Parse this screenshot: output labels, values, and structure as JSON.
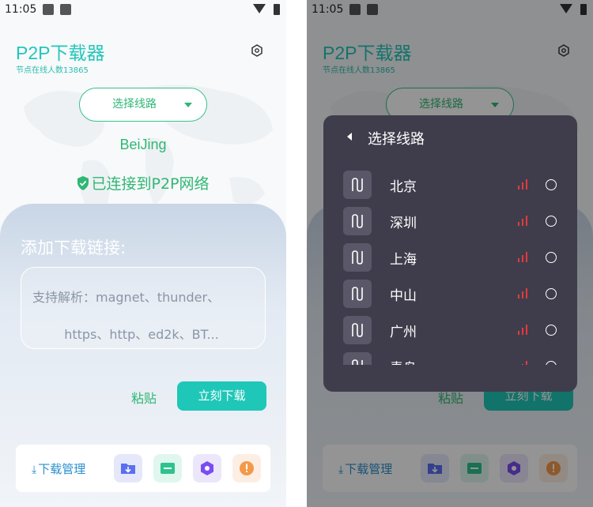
{
  "status": {
    "time": "11:05"
  },
  "app": {
    "title": "P2P下载器",
    "subtitle": "节点在线人数13865",
    "route_button": "选择线路",
    "city": "BeiJing",
    "connection_status": "已连接到P2P网络"
  },
  "panel": {
    "title": "添加下载链接:",
    "placeholder_line1": "支持解析：magnet、thunder、",
    "placeholder_line2": "https、http、ed2k、BT...",
    "paste_label": "粘贴",
    "download_label": "立刻下载"
  },
  "bottom_bar": {
    "download_manager": "下载管理",
    "icons": [
      "folder-download-icon",
      "file-box-icon",
      "hexagon-settings-icon",
      "alert-icon"
    ]
  },
  "dialog": {
    "title": "选择线路",
    "routes": [
      {
        "name": "北京"
      },
      {
        "name": "深圳"
      },
      {
        "name": "上海"
      },
      {
        "name": "中山"
      },
      {
        "name": "广州"
      },
      {
        "name": "青岛"
      }
    ]
  },
  "colors": {
    "accent": "#22c7bb",
    "green": "#2fb774",
    "dialog_bg": "#3f3d4c",
    "signal_red": "#e23b3b"
  }
}
